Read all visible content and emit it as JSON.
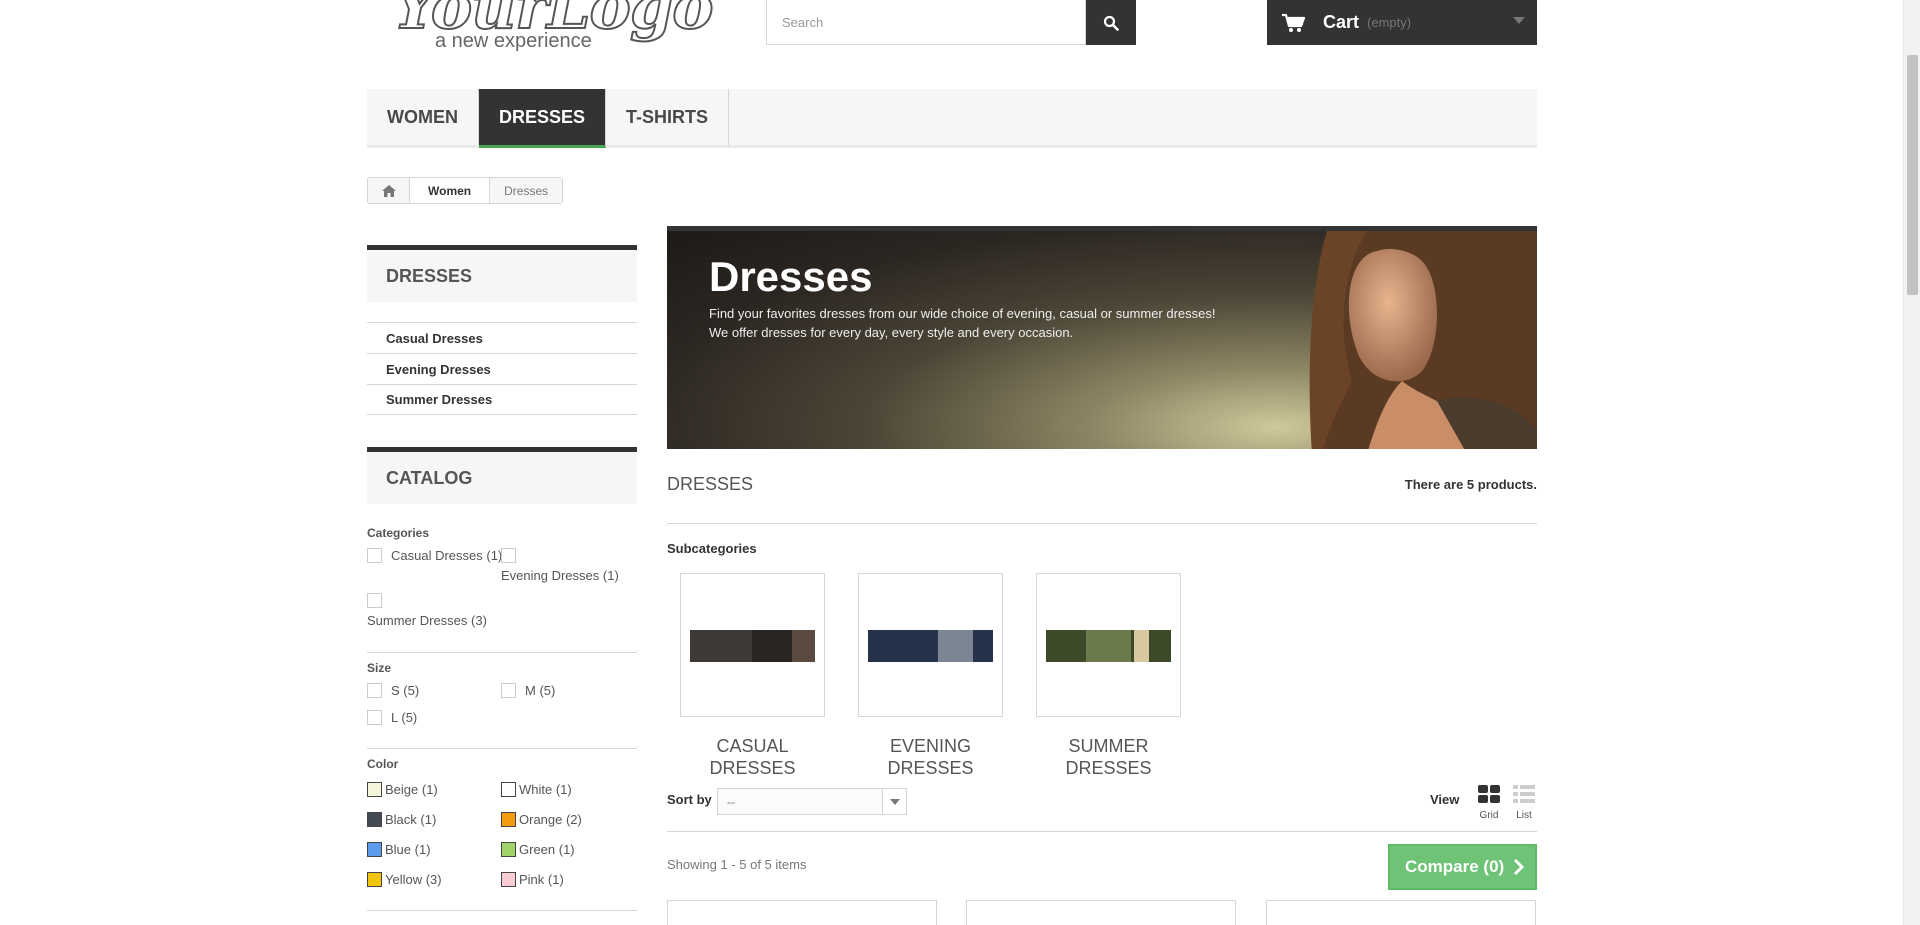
{
  "header": {
    "logo_main": "YourLogo",
    "logo_sub": "a new experience",
    "search_placeholder": "Search",
    "cart_label": "Cart",
    "cart_status": "(empty)"
  },
  "menu": {
    "items": [
      "Women",
      "Dresses",
      "T-shirts"
    ],
    "active": "Dresses"
  },
  "breadcrumb": {
    "items": [
      "Women",
      "Dresses"
    ]
  },
  "sidebar": {
    "category_block_title": "DRESSES",
    "categories": [
      "Casual Dresses",
      "Evening Dresses",
      "Summer Dresses"
    ],
    "catalog_title": "CATALOG",
    "filters": {
      "categories_title": "Categories",
      "categories": [
        "Casual Dresses (1)",
        "Evening Dresses (1)",
        "Summer Dresses (3)"
      ],
      "size_title": "Size",
      "sizes": [
        "S (5)",
        "M (5)",
        "L (5)"
      ],
      "color_title": "Color",
      "colors": [
        {
          "label": "Beige (1)",
          "color": "#f5f5dc"
        },
        {
          "label": "White (1)",
          "color": "#ffffff"
        },
        {
          "label": "Black (1)",
          "color": "#434a54"
        },
        {
          "label": "Orange (2)",
          "color": "#f39c11"
        },
        {
          "label": "Blue (1)",
          "color": "#5d9cec"
        },
        {
          "label": "Green (1)",
          "color": "#a0d468"
        },
        {
          "label": "Yellow (3)",
          "color": "#f1c40f"
        },
        {
          "label": "Pink (1)",
          "color": "#fcccd4"
        }
      ]
    }
  },
  "banner": {
    "title": "Dresses",
    "line1": "Find your favorites dresses from our wide choice of evening, casual or summer dresses!",
    "line2": "We offer dresses for every day, every style and every occasion."
  },
  "listing": {
    "heading": "DRESSES",
    "product_count": "There are 5 products.",
    "subcategories_title": "Subcategories",
    "subcategories": [
      "CASUAL DRESSES",
      "EVENING DRESSES",
      "SUMMER DRESSES"
    ],
    "sort_by_label": "Sort by",
    "sort_by_value": "--",
    "view_label": "View",
    "view_grid": "Grid",
    "view_list": "List",
    "showing": "Showing 1 - 5 of 5 items",
    "compare_label": "Compare (0)"
  },
  "colors": {
    "dark": "#333333",
    "accent_green": "#46a74e",
    "compare_green": "#6ec376"
  }
}
